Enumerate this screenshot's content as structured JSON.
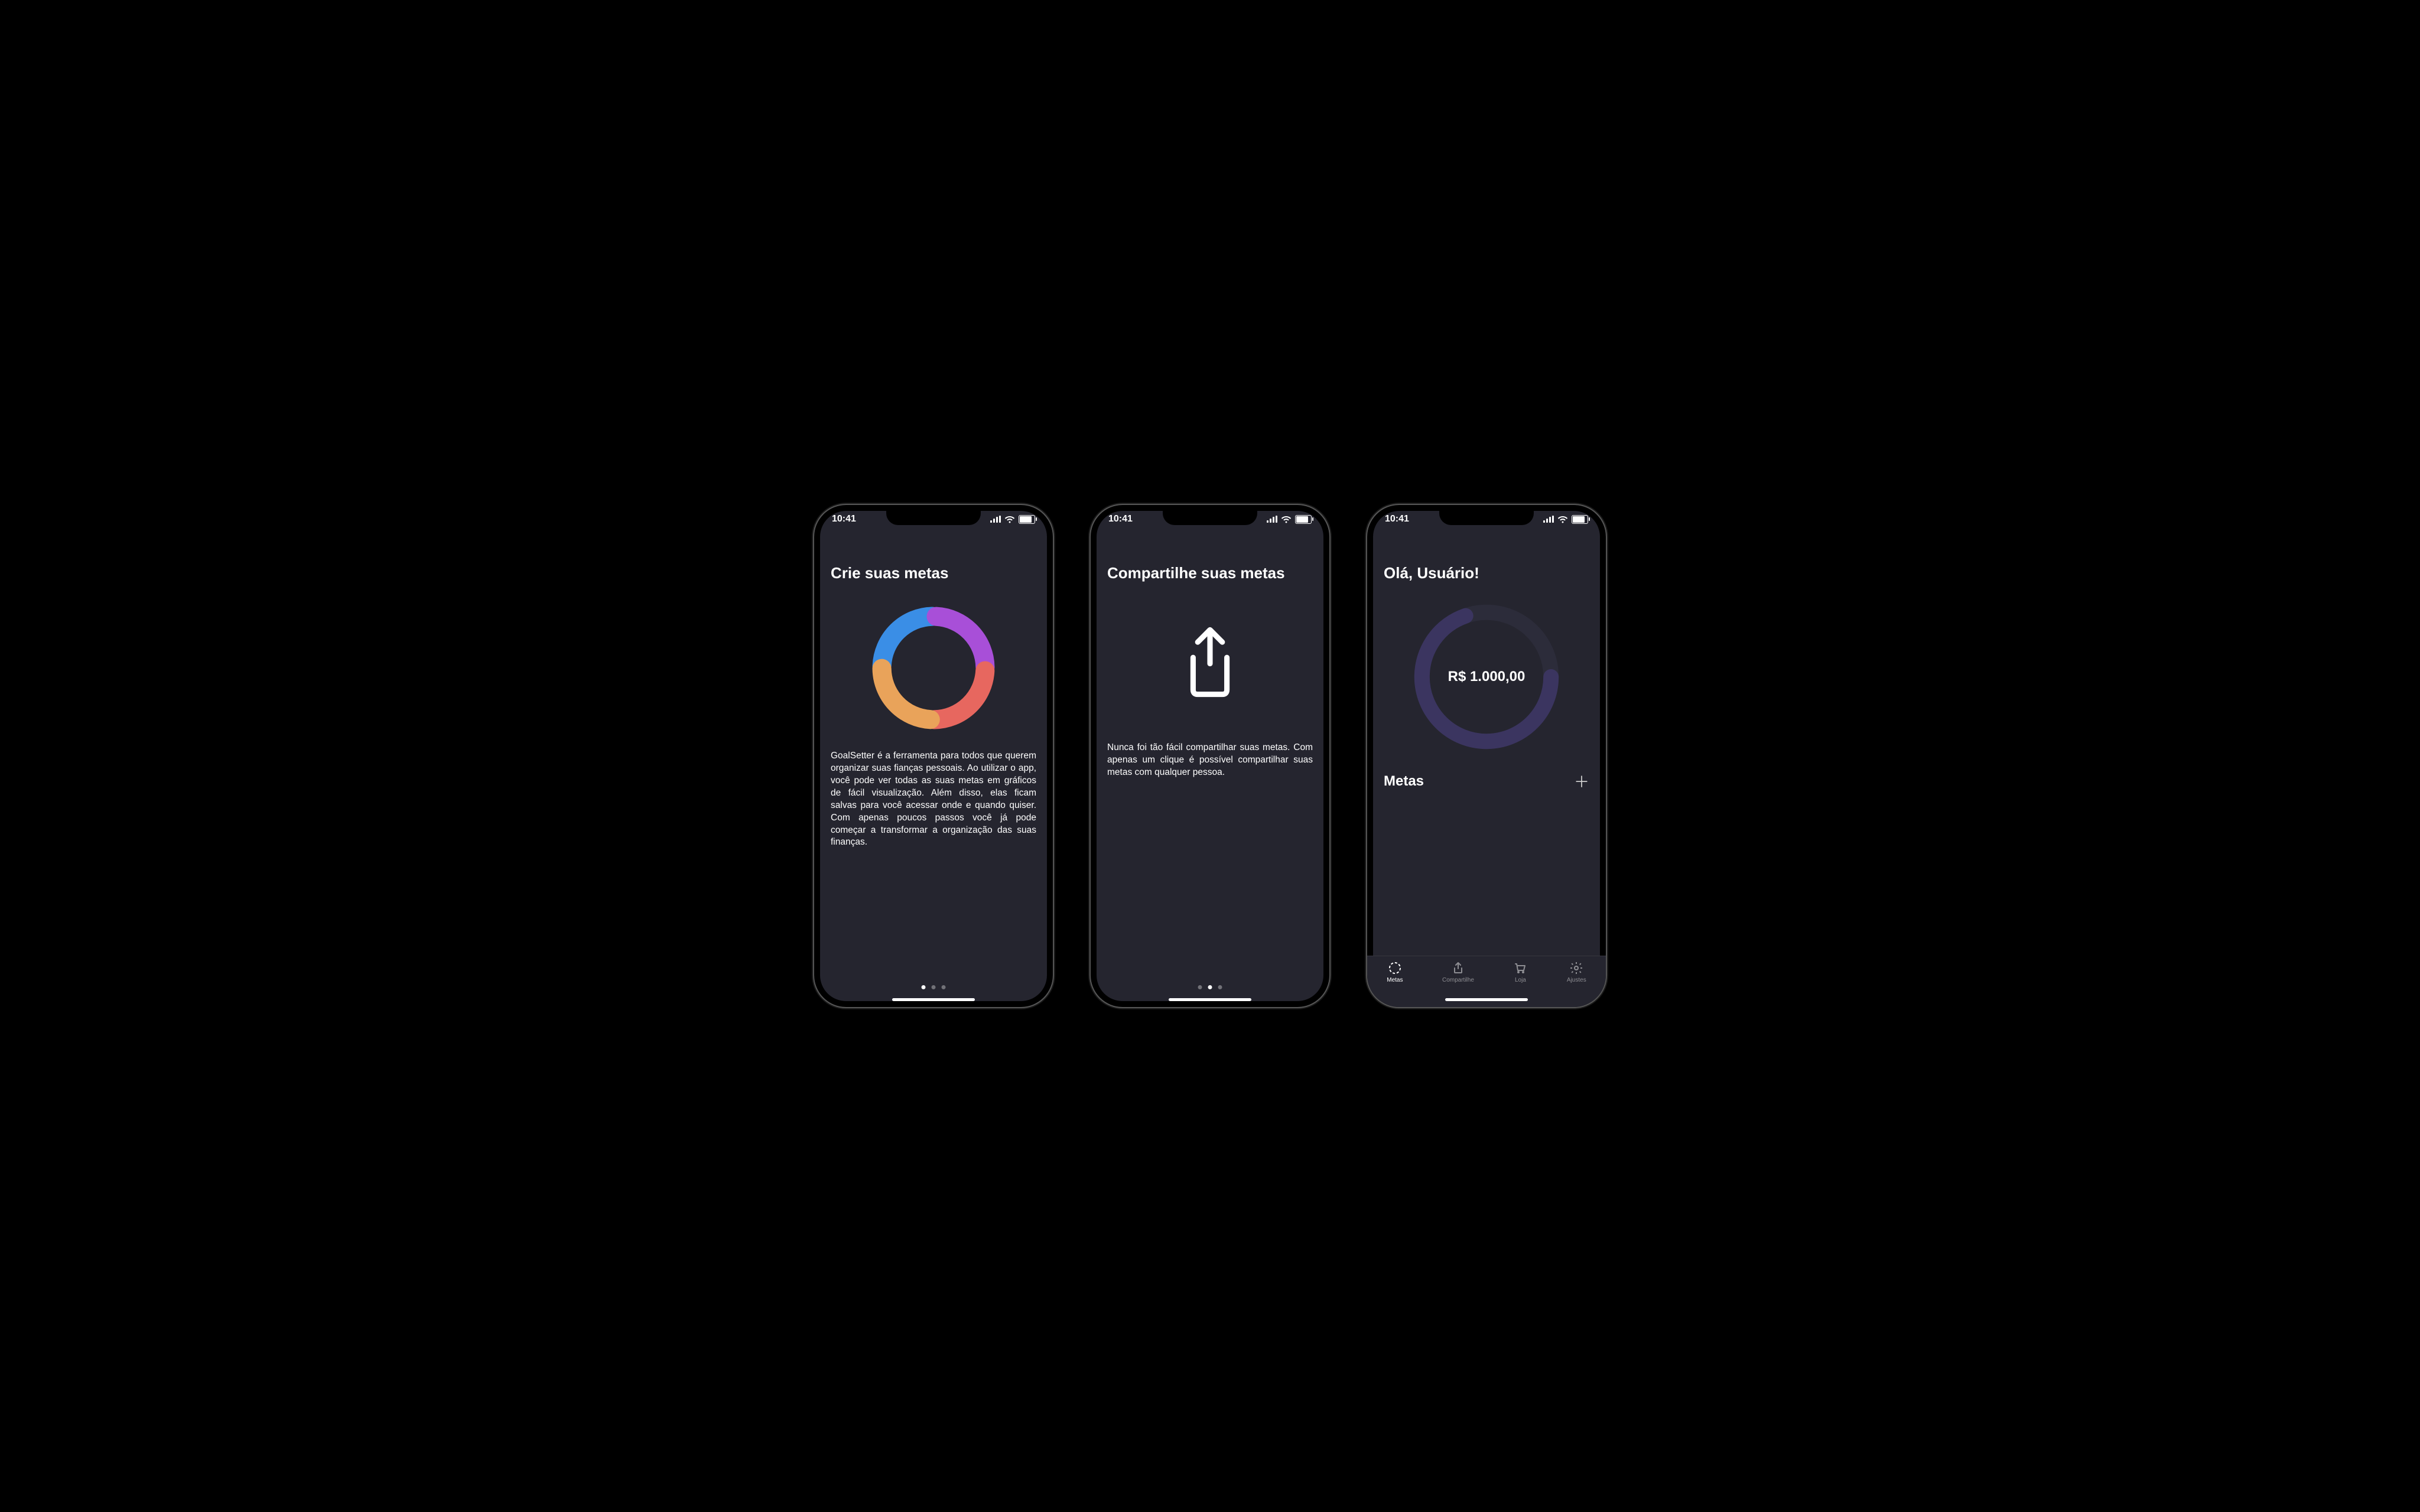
{
  "status_time": "10:41",
  "screen1": {
    "title": "Crie suas metas",
    "desc": "GoalSetter é a ferramenta para todos que querem organizar suas fianças pessoais. Ao utilizar o app, você pode ver todas as suas metas em gráficos de fácil visualização. Além disso, elas ficam salvas para você acessar onde e quando quiser. Com apenas poucos passos você já pode começar a transformar a organização das suas finanças."
  },
  "screen2": {
    "title": "Compartilhe suas metas",
    "desc": "Nunca foi tão fácil compartilhar suas metas. Com apenas um clique é possível compartilhar suas metas com qualquer pessoa."
  },
  "screen3": {
    "greeting": "Olá, Usuário!",
    "amount": "R$ 1.000,00",
    "section": "Metas",
    "tabs": {
      "metas": "Metas",
      "compartilhe": "Compartilhe",
      "loja": "Loja",
      "ajustes": "Ajustes"
    }
  },
  "chart_data": {
    "type": "pie",
    "title": "",
    "series": [
      {
        "name": "Azul",
        "value": 25,
        "color": "#3a8ee6"
      },
      {
        "name": "Roxo",
        "value": 25,
        "color": "#a84fd8"
      },
      {
        "name": "Vermelho",
        "value": 25,
        "color": "#e7675f"
      },
      {
        "name": "Laranja",
        "value": 25,
        "color": "#e9a35a"
      }
    ]
  }
}
